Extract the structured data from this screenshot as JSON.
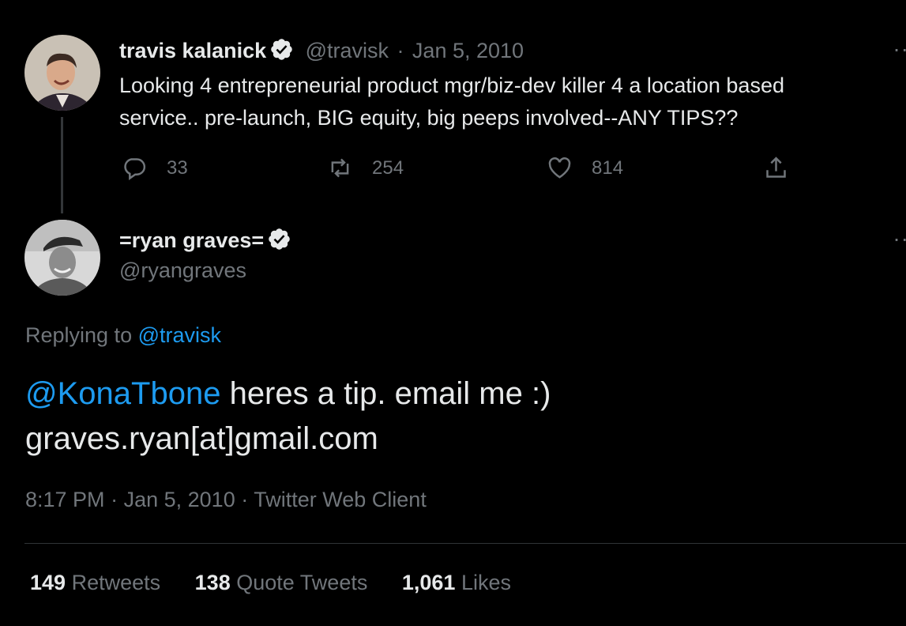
{
  "parent_tweet": {
    "author_name": "travis kalanick",
    "handle": "@travisk",
    "separator": "·",
    "date": "Jan 5, 2010",
    "text_line1": "Looking 4 entrepreneurial product mgr/biz-dev killer 4 a location based",
    "text_line2": "service.. pre-launch, BIG equity, big peeps involved--ANY TIPS??",
    "reply_count": "33",
    "retweet_count": "254",
    "like_count": "814",
    "more": "··"
  },
  "reply_tweet": {
    "author_name": "=ryan graves=",
    "handle": "@ryangraves",
    "more": "··",
    "replying_to_prefix": "Replying to",
    "replying_to_handle": "@travisk",
    "mention": "@KonaTbone",
    "text_rest": " heres a tip. email me :)",
    "text_line2": "graves.ryan[at]gmail.com",
    "time": "8:17 PM",
    "date": "Jan 5, 2010",
    "separator": "·",
    "client": "Twitter Web Client",
    "stats": {
      "retweets_count": "149",
      "retweets_label": "Retweets",
      "quotes_count": "138",
      "quotes_label": "Quote Tweets",
      "likes_count": "1,061",
      "likes_label": "Likes"
    }
  },
  "colors": {
    "background": "#000000",
    "text": "#e7e9ea",
    "muted": "#71767b",
    "link": "#1d9bf0",
    "divider": "#2f3336"
  },
  "icons": [
    "verified-badge-icon",
    "reply-icon",
    "retweet-icon",
    "like-icon",
    "share-icon",
    "more-icon"
  ]
}
